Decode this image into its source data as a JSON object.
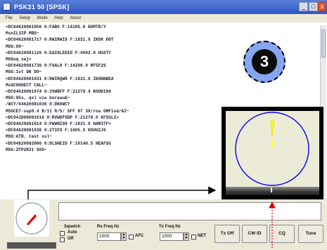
{
  "window": {
    "title": "PSK31 50 [SPSK]",
    "min_icon": "minimize-icon",
    "max_icon": "maximize-icon",
    "close_icon": "close-icon"
  },
  "menu": [
    "File",
    "Setup",
    "Mode",
    "Help",
    "About"
  ],
  "log_lines": [
    "<DC04620081056 0:FAB0 F:14105.0 HUMTR/Y",
    "MsoIL3IP MBS~",
    "<DC04620081717 0:RWIRWI9 F:1831.0 IKO8 DOT",
    "MSG:00~",
    "<DC04620081126 0:EAI9LEDID F:4002.0 HSSTY",
    "MSGuq sej>",
    "<DC04620081736 0:FSAL0 F:14208.0 MF5F2S",
    "MSG:1vt 9N DO~",
    "<DC04620081031 0:RWIRQWR F:1831.0 IK0NNBEA",
    "MsGC0OHECT CALL~",
    "<DC04620081074 0:3VWBFF F:21278.4 KOUDI60",
    "MSG:85s, qsl via bureau&~",
    "/WCY/04620081036 0:DK0WCY",
    "MSGCE7-sup0.4 B/11 R/5/ SFF 97 30/roa GMF1sd/AI~",
    "<DC04JD08081016 0:RVWDFSDP F:21278.0 KFS5LI>",
    "<DC04620081014 0:PWWRZ09 F:1831.0 HAM3TF>",
    "<DC04620081038 0:2TICO F:1805.5 KOUUZJ0",
    "MSG:ATB, test ssl~",
    "<DC04620082006 0:DLSHEID F:10140.5 HEAFSG",
    "MSG:ZFP2R31 S00~"
  ],
  "badge": {
    "number": "3"
  },
  "bottom": {
    "squelch_label": "Squelch",
    "auto_label": "Auto",
    "off_label": "Off",
    "rx_freq_label": "Rx Freq Hz",
    "rx_freq_value": "1000",
    "afc_label": "AFC",
    "tx_freq_label": "Tx Freq Hz",
    "tx_freq_value": "1000",
    "net_label": "NET",
    "buttons": [
      "Tx Off",
      "CW ID",
      "CQ",
      "Tune"
    ]
  },
  "colors": {
    "title": "#2f56c4",
    "badge": "#87a6f0",
    "arrow_red": "#e00000",
    "scope_ring": "#0000ff",
    "scope_needle": "#ffff00"
  }
}
